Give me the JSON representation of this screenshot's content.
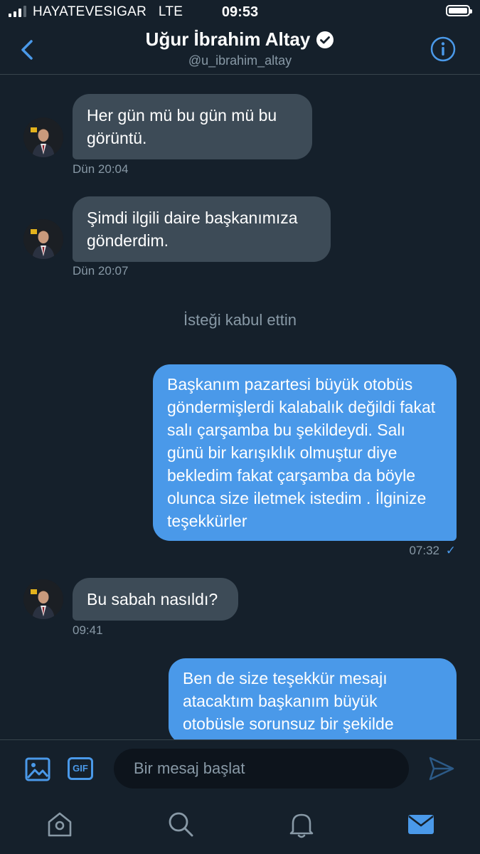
{
  "status_bar": {
    "carrier": "HAYATEVESIGAR",
    "network": "LTE",
    "time": "09:53"
  },
  "header": {
    "name": "Uğur İbrahim Altay",
    "handle": "@u_ibrahim_altay",
    "back_icon": "chevron-left-icon",
    "info_icon": "info-icon",
    "verified_icon": "verified-badge-icon"
  },
  "messages": [
    {
      "direction": "in",
      "text": "Her gün mü bu gün mü bu görüntü.",
      "time": "Dün 20:04"
    },
    {
      "direction": "in",
      "text": "Şimdi ilgili daire başkanımıza gönderdim.",
      "time": "Dün 20:07"
    },
    {
      "direction": "system",
      "text": "İsteği kabul ettin"
    },
    {
      "direction": "out",
      "text": "Başkanım pazartesi büyük otobüs göndermişlerdi kalabalık değildi fakat salı çarşamba bu şekildeydi. Salı günü bir karışıklık olmuştur diye bekledim fakat çarşamba da böyle olunca size iletmek istedim . İlginize teşekkürler",
      "time": "07:32",
      "status": "✓"
    },
    {
      "direction": "in",
      "text": "Bu sabah nasıldı?",
      "time": "09:41"
    },
    {
      "direction": "out",
      "text": "Ben de size teşekkür mesajı atacaktım başkanım büyük otobüsle sorunsuz bir şekilde"
    }
  ],
  "composer": {
    "placeholder": "Bir mesaj başlat",
    "gif_label": "GIF",
    "image_icon": "image-icon",
    "send_icon": "send-icon"
  },
  "tabbar": {
    "items": [
      "home-icon",
      "search-icon",
      "notifications-icon",
      "messages-icon"
    ],
    "active": "messages-icon"
  },
  "colors": {
    "background": "#15202b",
    "incoming_bubble": "#3d4b57",
    "outgoing_bubble": "#4a99e9",
    "accent": "#4a99e9",
    "secondary_text": "#8899a6"
  }
}
